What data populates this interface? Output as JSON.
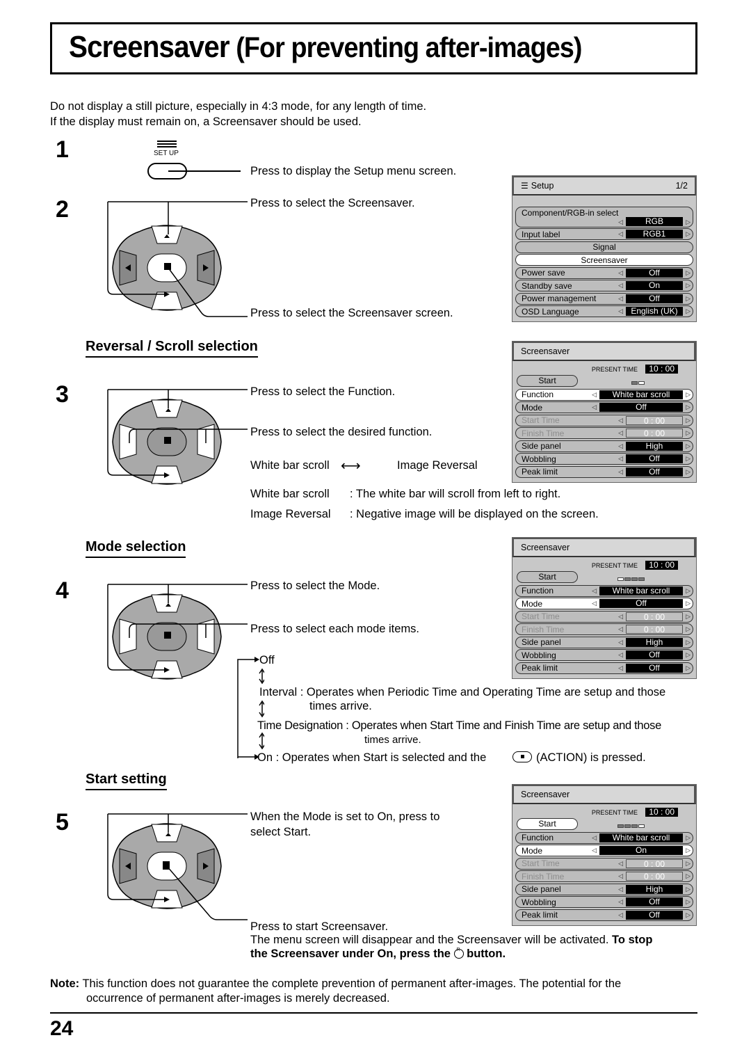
{
  "title": {
    "main": "Screensaver",
    "sub": "(For preventing after-images)"
  },
  "intro": [
    "Do not display a still picture, especially in 4:3 mode, for any length of time.",
    "If the display must remain on, a Screensaver should be used."
  ],
  "steps": {
    "s1": {
      "num": "1",
      "button_label": "SET UP",
      "text": "Press to display the Setup menu screen."
    },
    "s2": {
      "num": "2",
      "text_up": "Press to select the Screensaver.",
      "text_action": "Press to select the Screensaver screen."
    },
    "s3": {
      "num": "3",
      "heading": "Reversal / Scroll selection",
      "text_up": "Press to select the Function.",
      "text_lr": "Press to select the desired function.",
      "cycle_a": "White bar scroll",
      "cycle_b": "Image Reversal",
      "defs": [
        {
          "term": "White bar scroll",
          "desc": ": The white bar will scroll from left to right."
        },
        {
          "term": "Image Reversal",
          "desc": ": Negative image will be displayed on the screen."
        }
      ]
    },
    "s4": {
      "num": "4",
      "heading": "Mode selection",
      "text_up": "Press to select the Mode.",
      "text_lr": "Press to select each mode items.",
      "modes": {
        "off": "Off",
        "interval_1": "Interval : Operates when Periodic Time and Operating Time are setup and those",
        "interval_2": "times arrive.",
        "td_1": "Time Designation : Operates when Start Time and Finish Time are setup and those",
        "td_2": "times arrive.",
        "on_a": "On : Operates when Start is selected and the",
        "on_b": "(ACTION) is pressed."
      }
    },
    "s5": {
      "num": "5",
      "heading": "Start setting",
      "text_up_1": "When the Mode is set to On, press to",
      "text_up_2": "select Start.",
      "text_action": "Press to start Screensaver.",
      "note_1": "The menu screen will disappear and the Screensaver will be activated.",
      "note_1b": "To stop",
      "note_2a": "the Screensaver under On, press the",
      "note_2b": "button.",
      "r_label": "R"
    }
  },
  "note": {
    "label": "Note:",
    "line1": "This function does not guarantee the complete prevention of permanent after-images. The potential for the",
    "line2": "occurrence of permanent after-images is merely decreased."
  },
  "page_number": "24",
  "setup_menu": {
    "title": "Setup",
    "page": "1/2",
    "rows": [
      {
        "label": "Component/RGB-in  select",
        "value": "RGB"
      },
      {
        "label": "Input label",
        "value": "RGB1"
      },
      {
        "label": "Signal"
      },
      {
        "label": "Screensaver"
      },
      {
        "label": "Power save",
        "value": "Off"
      },
      {
        "label": "Standby save",
        "value": "On"
      },
      {
        "label": "Power management",
        "value": "Off"
      },
      {
        "label": "OSD  Language",
        "value": "English (UK)"
      }
    ]
  },
  "ss_menus": [
    {
      "title": "Screensaver",
      "present_label": "PRESENT TIME",
      "time": "10 : 00",
      "start": "Start",
      "rows": [
        {
          "label": "Function",
          "value": "White bar scroll"
        },
        {
          "label": "Mode",
          "value": "Off"
        },
        {
          "label": "Start Time",
          "value": "0 : 00"
        },
        {
          "label": "Finish Time",
          "value": "0 : 00"
        },
        {
          "label": "Side  panel",
          "value": "High"
        },
        {
          "label": "Wobbling",
          "value": "Off"
        },
        {
          "label": "Peak limit",
          "value": "Off"
        }
      ]
    },
    {
      "title": "Screensaver",
      "present_label": "PRESENT TIME",
      "time": "10 : 00",
      "start": "Start",
      "rows": [
        {
          "label": "Function",
          "value": "White bar scroll"
        },
        {
          "label": "Mode",
          "value": "Off"
        },
        {
          "label": "Start Time",
          "value": "0 : 00"
        },
        {
          "label": "Finish Time",
          "value": "0 : 00"
        },
        {
          "label": "Side  panel",
          "value": "High"
        },
        {
          "label": "Wobbling",
          "value": "Off"
        },
        {
          "label": "Peak limit",
          "value": "Off"
        }
      ]
    },
    {
      "title": "Screensaver",
      "present_label": "PRESENT TIME",
      "time": "10 : 00",
      "start": "Start",
      "rows": [
        {
          "label": "Function",
          "value": "White bar scroll"
        },
        {
          "label": "Mode",
          "value": "On"
        },
        {
          "label": "Start Time",
          "value": "0 : 00"
        },
        {
          "label": "Finish Time",
          "value": "0 : 00"
        },
        {
          "label": "Side  panel",
          "value": "High"
        },
        {
          "label": "Wobbling",
          "value": "Off"
        },
        {
          "label": "Peak limit",
          "value": "Off"
        }
      ]
    }
  ]
}
